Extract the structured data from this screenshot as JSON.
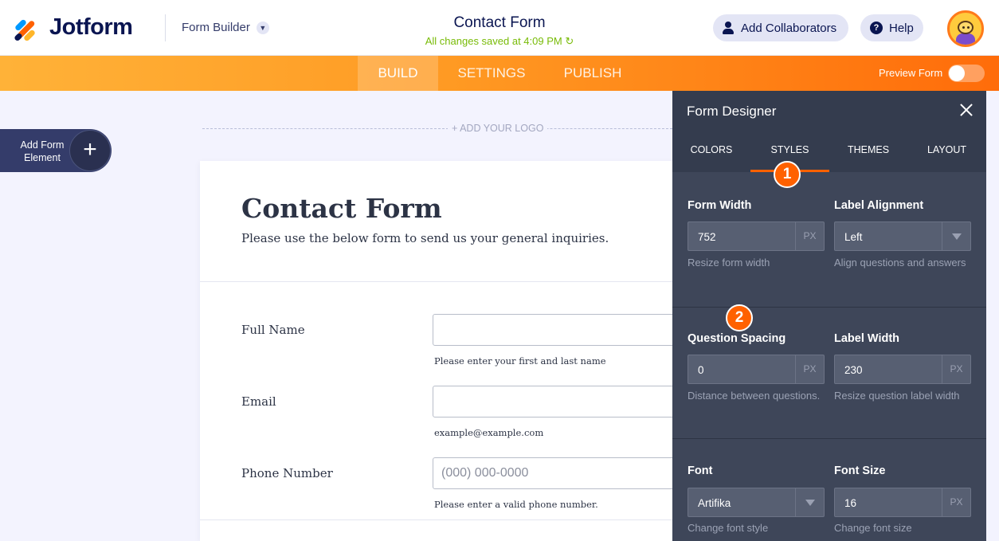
{
  "header": {
    "brand": "Jotform",
    "builder_menu": "Form Builder",
    "form_title": "Contact Form",
    "saved_status": "All changes saved at 4:09 PM",
    "add_collaborators": "Add Collaborators",
    "help": "Help"
  },
  "nav": {
    "tabs": [
      {
        "label": "BUILD",
        "active": true
      },
      {
        "label": "SETTINGS",
        "active": false
      },
      {
        "label": "PUBLISH",
        "active": false
      }
    ],
    "preview_label": "Preview Form",
    "preview_on": false
  },
  "canvas": {
    "add_element": "Add Form Element",
    "add_logo": "+ ADD YOUR LOGO"
  },
  "form": {
    "title": "Contact Form",
    "subtitle": "Please use the below form to send us your general inquiries.",
    "questions": [
      {
        "label": "Full Name",
        "placeholder": "",
        "hint": "Please enter your first and last name"
      },
      {
        "label": "Email",
        "placeholder": "",
        "hint": "example@example.com"
      },
      {
        "label": "Phone Number",
        "placeholder": "(000) 000-0000",
        "hint": "Please enter a valid phone number."
      }
    ]
  },
  "designer": {
    "title": "Form Designer",
    "tabs": [
      "COLORS",
      "STYLES",
      "THEMES",
      "LAYOUT"
    ],
    "active_tab": "STYLES",
    "badges": [
      "1",
      "2"
    ],
    "fields": {
      "form_width": {
        "label": "Form Width",
        "value": "752",
        "unit": "PX",
        "hint": "Resize form width"
      },
      "label_alignment": {
        "label": "Label Alignment",
        "value": "Left",
        "hint": "Align questions and answers"
      },
      "question_spacing": {
        "label": "Question Spacing",
        "value": "0",
        "unit": "PX",
        "hint": "Distance between questions."
      },
      "label_width": {
        "label": "Label Width",
        "value": "230",
        "unit": "PX",
        "hint": "Resize question label width"
      },
      "font": {
        "label": "Font",
        "value": "Artifika",
        "hint": "Change font style"
      },
      "font_size": {
        "label": "Font Size",
        "value": "16",
        "unit": "PX",
        "hint": "Change font size"
      }
    }
  },
  "colors": {
    "accent": "#ff6100",
    "navy": "#0a1551",
    "panel": "#3e4659",
    "saved_green": "#78bb07"
  }
}
